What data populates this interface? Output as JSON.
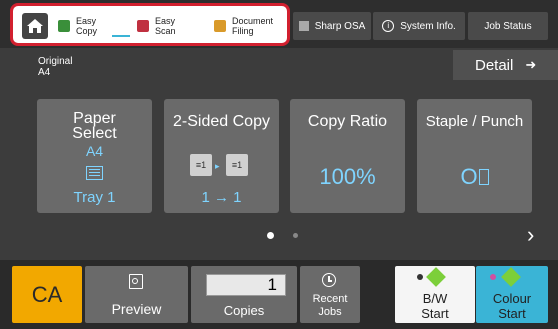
{
  "topbar": {
    "shortcuts": [
      {
        "label": "Easy\nCopy",
        "icon": "easy-copy-icon"
      },
      {
        "label": "Easy\nScan",
        "icon": "easy-scan-icon"
      },
      {
        "label": "Document\nFiling",
        "icon": "document-filing-icon"
      }
    ],
    "buttons": [
      {
        "label": "Sharp OSA",
        "icon": "sharp-osa-icon"
      },
      {
        "label": "System Info.",
        "icon": "info-icon"
      },
      {
        "label": "Job Status"
      }
    ]
  },
  "original": {
    "label": "Original",
    "value": "A4"
  },
  "detail": {
    "label": "Detail"
  },
  "tiles": [
    {
      "title": "Paper\nSelect",
      "value": "A4",
      "sub": "Tray 1"
    },
    {
      "title": "2-Sided Copy",
      "value": "1 → 1"
    },
    {
      "title": "Copy Ratio",
      "value": "100%"
    },
    {
      "title": "Staple / Punch",
      "value": "O"
    }
  ],
  "bottom": {
    "ca": "CA",
    "preview": "Preview",
    "copies_value": "1",
    "copies_label": "Copies",
    "recent_jobs": "Recent\nJobs",
    "bw_start": "B/W\nStart",
    "colour_start": "Colour\nStart"
  },
  "colors": {
    "accent_red": "#d2202f",
    "value_blue": "#7fd4ff",
    "ca_orange": "#f2a800",
    "colour_start_blue": "#3ab4d6"
  }
}
